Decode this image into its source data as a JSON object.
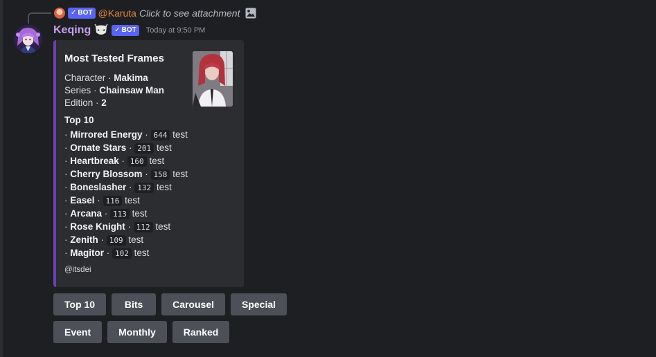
{
  "reply": {
    "bot_tag": "BOT",
    "author": "@Karuta",
    "text": "Click to see attachment",
    "icon": "image-icon"
  },
  "message": {
    "username": "Keqing",
    "bot_tag": "BOT",
    "timestamp": "Today at 9:50 PM"
  },
  "embed": {
    "accent_color": "#6d3fb5",
    "title": "Most Tested Frames",
    "character_label": "Character",
    "character": "Makima",
    "series_label": "Series",
    "series": "Chainsaw Man",
    "edition_label": "Edition",
    "edition": "2",
    "top_title": "Top 10",
    "frames": [
      {
        "name": "Mirrored Energy",
        "count": "644",
        "unit": "test"
      },
      {
        "name": "Ornate Stars",
        "count": "201",
        "unit": "test"
      },
      {
        "name": "Heartbreak",
        "count": "160",
        "unit": "test"
      },
      {
        "name": "Cherry Blossom",
        "count": "158",
        "unit": "test"
      },
      {
        "name": "Boneslasher",
        "count": "132",
        "unit": "test"
      },
      {
        "name": "Easel",
        "count": "116",
        "unit": "test"
      },
      {
        "name": "Arcana",
        "count": "113",
        "unit": "test"
      },
      {
        "name": "Rose Knight",
        "count": "112",
        "unit": "test"
      },
      {
        "name": "Zenith",
        "count": "109",
        "unit": "test"
      },
      {
        "name": "Magitor",
        "count": "102",
        "unit": "test"
      }
    ],
    "footer": "@itsdei"
  },
  "buttons": {
    "row1": [
      "Top 10",
      "Bits",
      "Carousel",
      "Special"
    ],
    "row2": [
      "Event",
      "Monthly",
      "Ranked"
    ]
  }
}
